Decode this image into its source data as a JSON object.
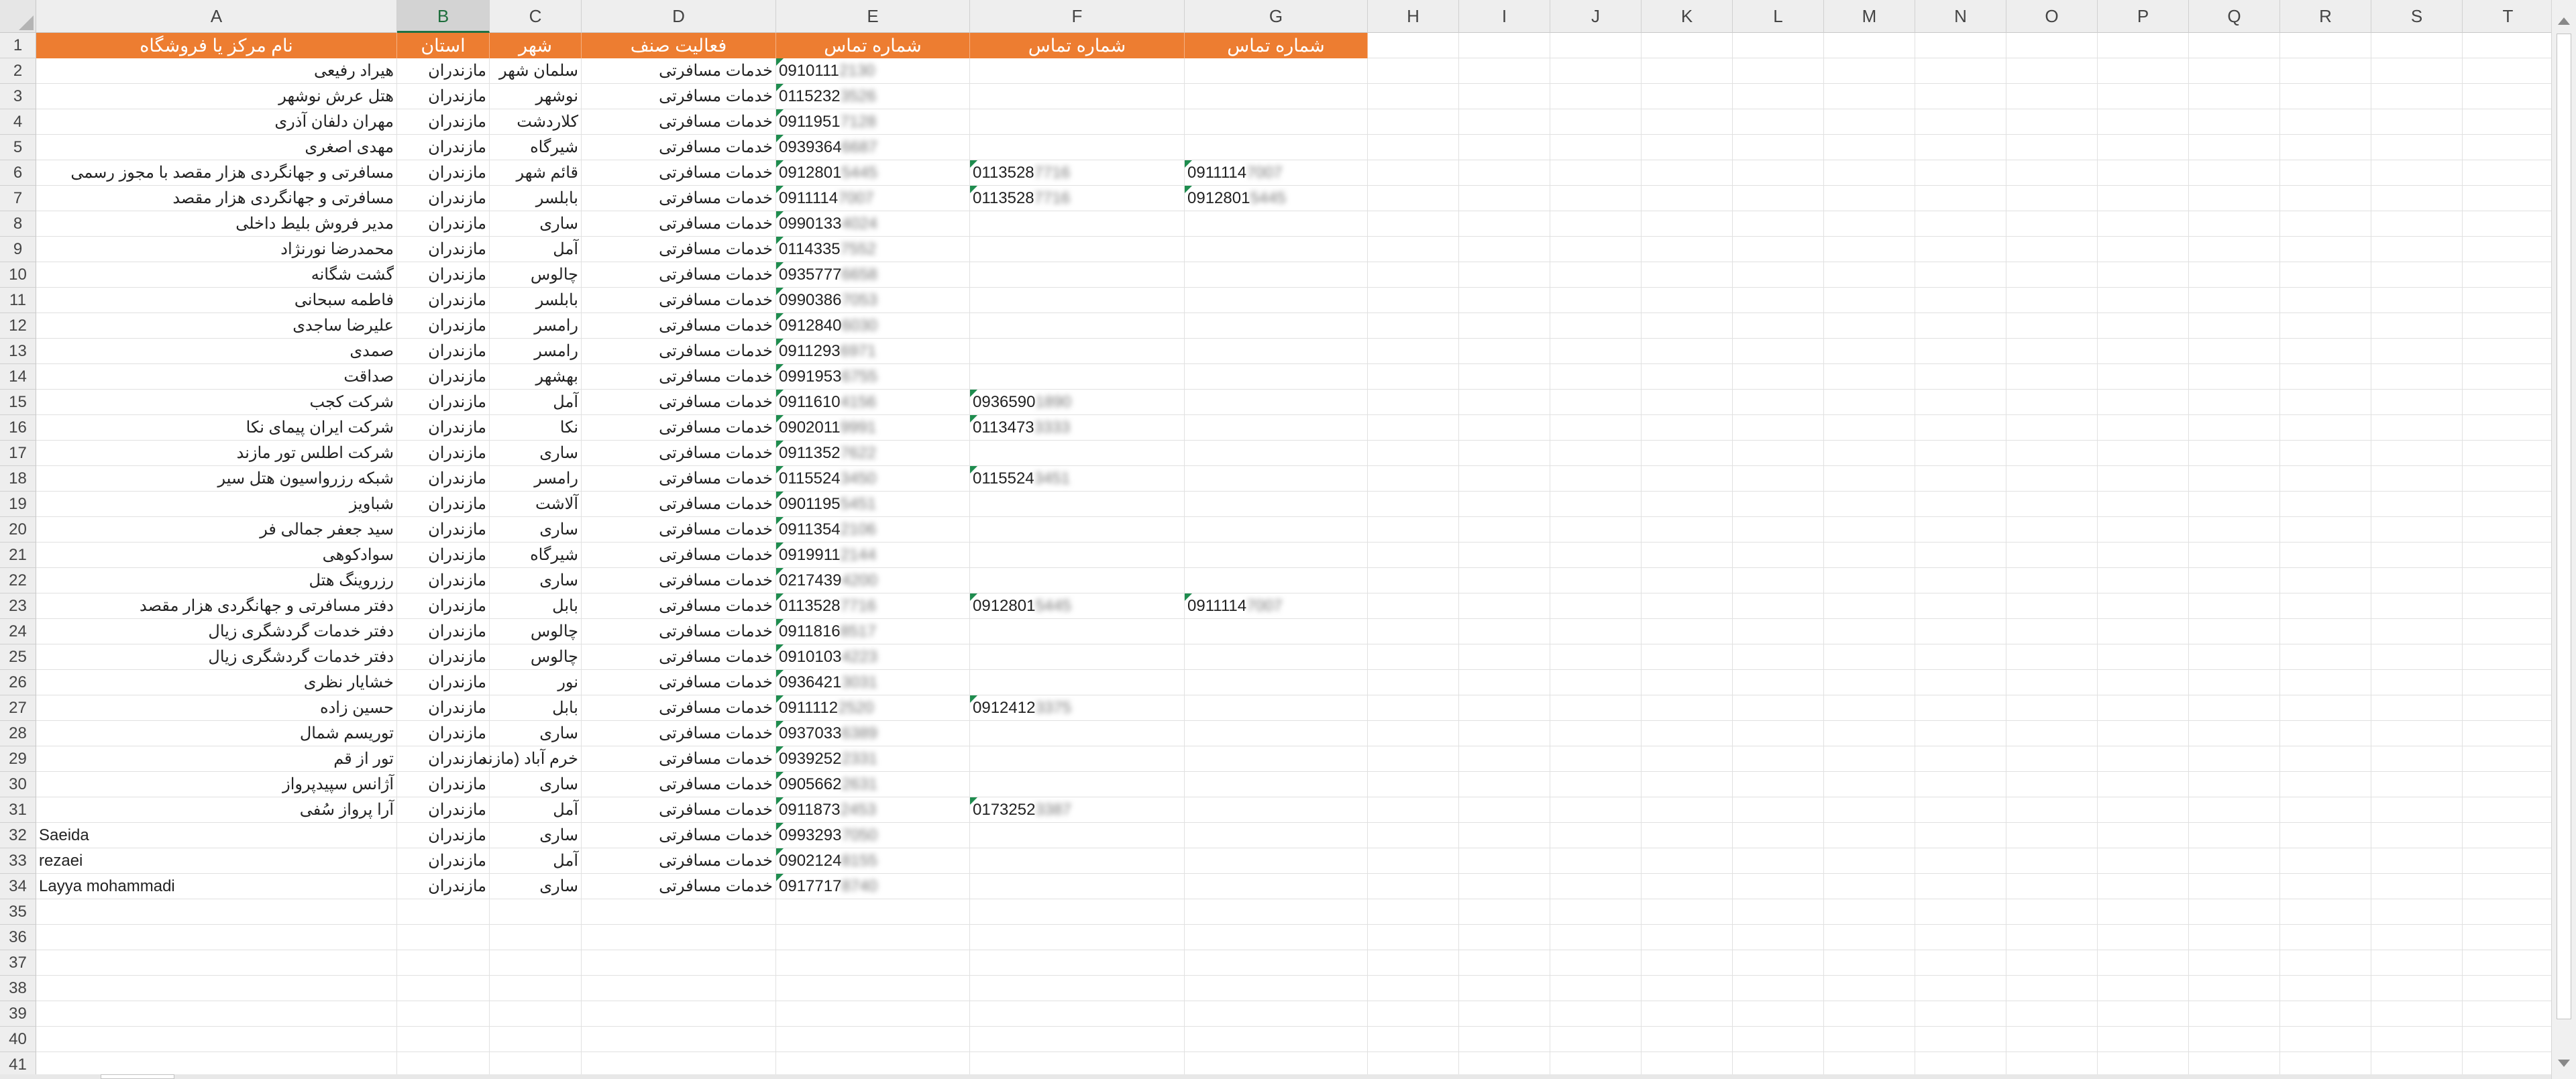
{
  "columns": [
    "A",
    "B",
    "C",
    "D",
    "E",
    "F",
    "G",
    "H",
    "I",
    "J",
    "K",
    "L",
    "M",
    "N",
    "O",
    "P",
    "Q",
    "R",
    "S",
    "T"
  ],
  "selected_column": "B",
  "headers": {
    "A": "نام مرکز یا فروشگاه",
    "B": "استان",
    "C": "شهر",
    "D": "فعالیت صنف",
    "E": "شماره تماس",
    "F": "شماره تماس",
    "G": "شماره تماس"
  },
  "row_numbers": [
    "1",
    "2",
    "3",
    "4",
    "5",
    "6",
    "7",
    "8",
    "9",
    "10",
    "11",
    "12",
    "13",
    "14",
    "15",
    "16",
    "17",
    "18",
    "19",
    "20",
    "21",
    "22",
    "23",
    "24",
    "25",
    "26",
    "27",
    "28",
    "29",
    "30",
    "31",
    "32",
    "33",
    "34",
    "35",
    "36",
    "37",
    "38",
    "39",
    "40",
    "41"
  ],
  "rows": [
    {
      "name": "هیراد رفیعی",
      "province": "مازندران",
      "city": "سلمان شهر",
      "activity": "خدمات مسافرتی",
      "phone1": "0910111",
      "phone1_blur": "2130",
      "phone2": "",
      "phone2_blur": "",
      "phone3": "",
      "phone3_blur": ""
    },
    {
      "name": "هتل عرش نوشهر",
      "province": "مازندران",
      "city": "نوشهر",
      "activity": "خدمات مسافرتی",
      "phone1": "0115232",
      "phone1_blur": "3526",
      "phone2": "",
      "phone2_blur": "",
      "phone3": "",
      "phone3_blur": ""
    },
    {
      "name": "مهران دلفان آذری",
      "province": "مازندران",
      "city": "کلاردشت",
      "activity": "خدمات مسافرتی",
      "phone1": "0911951",
      "phone1_blur": "7128",
      "phone2": "",
      "phone2_blur": "",
      "phone3": "",
      "phone3_blur": ""
    },
    {
      "name": "مهدی اصغری",
      "province": "مازندران",
      "city": "شیرگاه",
      "activity": "خدمات مسافرتی",
      "phone1": "0939364",
      "phone1_blur": "6687",
      "phone2": "",
      "phone2_blur": "",
      "phone3": "",
      "phone3_blur": ""
    },
    {
      "name": "مسافرتی و جهانگردی هزار مقصد با مجوز رسمی",
      "province": "مازندران",
      "city": "قائم شهر",
      "activity": "خدمات مسافرتی",
      "phone1": "0912801",
      "phone1_blur": "5445",
      "phone2": "0113528",
      "phone2_blur": "7716",
      "phone3": "0911114",
      "phone3_blur": "7007"
    },
    {
      "name": "مسافرتی و جهانگردی هزار مقصد",
      "province": "مازندران",
      "city": "بابلسر",
      "activity": "خدمات مسافرتی",
      "phone1": "0911114",
      "phone1_blur": "7007",
      "phone2": "0113528",
      "phone2_blur": "7716",
      "phone3": "0912801",
      "phone3_blur": "5445"
    },
    {
      "name": "مدیر فروش بلیط داخلی",
      "province": "مازندران",
      "city": "ساری",
      "activity": "خدمات مسافرتی",
      "phone1": "0990133",
      "phone1_blur": "4024",
      "phone2": "",
      "phone2_blur": "",
      "phone3": "",
      "phone3_blur": ""
    },
    {
      "name": "محمدرضا نورنژاد",
      "province": "مازندران",
      "city": "آمل",
      "activity": "خدمات مسافرتی",
      "phone1": "0114335",
      "phone1_blur": "7552",
      "phone2": "",
      "phone2_blur": "",
      "phone3": "",
      "phone3_blur": ""
    },
    {
      "name": "گشت شگانه",
      "province": "مازندران",
      "city": "چالوس",
      "activity": "خدمات مسافرتی",
      "phone1": "0935777",
      "phone1_blur": "6658",
      "phone2": "",
      "phone2_blur": "",
      "phone3": "",
      "phone3_blur": ""
    },
    {
      "name": "فاطمه سبحانی",
      "province": "مازندران",
      "city": "بابلسر",
      "activity": "خدمات مسافرتی",
      "phone1": "0990386",
      "phone1_blur": "7053",
      "phone2": "",
      "phone2_blur": "",
      "phone3": "",
      "phone3_blur": ""
    },
    {
      "name": "علیرضا ساجدی",
      "province": "مازندران",
      "city": "رامسر",
      "activity": "خدمات مسافرتی",
      "phone1": "0912840",
      "phone1_blur": "6030",
      "phone2": "",
      "phone2_blur": "",
      "phone3": "",
      "phone3_blur": ""
    },
    {
      "name": "صمدی",
      "province": "مازندران",
      "city": "رامسر",
      "activity": "خدمات مسافرتی",
      "phone1": "0911293",
      "phone1_blur": "6971",
      "phone2": "",
      "phone2_blur": "",
      "phone3": "",
      "phone3_blur": ""
    },
    {
      "name": "صداقت",
      "province": "مازندران",
      "city": "بهشهر",
      "activity": "خدمات مسافرتی",
      "phone1": "0991953",
      "phone1_blur": "6755",
      "phone2": "",
      "phone2_blur": "",
      "phone3": "",
      "phone3_blur": ""
    },
    {
      "name": "شرکت کجب",
      "province": "مازندران",
      "city": "آمل",
      "activity": "خدمات مسافرتی",
      "phone1": "0911610",
      "phone1_blur": "4156",
      "phone2": "0936590",
      "phone2_blur": "1890",
      "phone3": "",
      "phone3_blur": ""
    },
    {
      "name": "شرکت ایران پیمای نکا",
      "province": "مازندران",
      "city": "نکا",
      "activity": "خدمات مسافرتی",
      "phone1": "0902011",
      "phone1_blur": "9991",
      "phone2": "0113473",
      "phone2_blur": "3333",
      "phone3": "",
      "phone3_blur": ""
    },
    {
      "name": "شرکت اطلس تور مازند",
      "province": "مازندران",
      "city": "ساری",
      "activity": "خدمات مسافرتی",
      "phone1": "0911352",
      "phone1_blur": "7622",
      "phone2": "",
      "phone2_blur": "",
      "phone3": "",
      "phone3_blur": ""
    },
    {
      "name": "شبکه رزرواسیون هتل سیر",
      "province": "مازندران",
      "city": "رامسر",
      "activity": "خدمات مسافرتی",
      "phone1": "0115524",
      "phone1_blur": "3450",
      "phone2": "0115524",
      "phone2_blur": "3451",
      "phone3": "",
      "phone3_blur": ""
    },
    {
      "name": "شباویز",
      "province": "مازندران",
      "city": "آلاشت",
      "activity": "خدمات مسافرتی",
      "phone1": "0901195",
      "phone1_blur": "5451",
      "phone2": "",
      "phone2_blur": "",
      "phone3": "",
      "phone3_blur": ""
    },
    {
      "name": "سید جعفر جمالی فر",
      "province": "مازندران",
      "city": "ساری",
      "activity": "خدمات مسافرتی",
      "phone1": "0911354",
      "phone1_blur": "2106",
      "phone2": "",
      "phone2_blur": "",
      "phone3": "",
      "phone3_blur": ""
    },
    {
      "name": "سوادکوهی",
      "province": "مازندران",
      "city": "شیرگاه",
      "activity": "خدمات مسافرتی",
      "phone1": "0919911",
      "phone1_blur": "2144",
      "phone2": "",
      "phone2_blur": "",
      "phone3": "",
      "phone3_blur": ""
    },
    {
      "name": "رزروینگ هتل",
      "province": "مازندران",
      "city": "ساری",
      "activity": "خدمات مسافرتی",
      "phone1": "0217439",
      "phone1_blur": "4200",
      "phone2": "",
      "phone2_blur": "",
      "phone3": "",
      "phone3_blur": ""
    },
    {
      "name": "دفتر مسافرتی و جهانگردی هزار مقصد",
      "province": "مازندران",
      "city": "بابل",
      "activity": "خدمات مسافرتی",
      "phone1": "0113528",
      "phone1_blur": "7716",
      "phone2": "0912801",
      "phone2_blur": "5445",
      "phone3": "0911114",
      "phone3_blur": "7007"
    },
    {
      "name": "دفتر خدمات گردشگری زیال",
      "province": "مازندران",
      "city": "چالوس",
      "activity": "خدمات مسافرتی",
      "phone1": "0911816",
      "phone1_blur": "8517",
      "phone2": "",
      "phone2_blur": "",
      "phone3": "",
      "phone3_blur": ""
    },
    {
      "name": "دفتر خدمات گردشگری زیال",
      "province": "مازندران",
      "city": "چالوس",
      "activity": "خدمات مسافرتی",
      "phone1": "0910103",
      "phone1_blur": "4223",
      "phone2": "",
      "phone2_blur": "",
      "phone3": "",
      "phone3_blur": ""
    },
    {
      "name": "خشایار نظری",
      "province": "مازندران",
      "city": "نور",
      "activity": "خدمات مسافرتی",
      "phone1": "0936421",
      "phone1_blur": "3031",
      "phone2": "",
      "phone2_blur": "",
      "phone3": "",
      "phone3_blur": ""
    },
    {
      "name": "حسین زاده",
      "province": "مازندران",
      "city": "بابل",
      "activity": "خدمات مسافرتی",
      "phone1": "0911112",
      "phone1_blur": "2520",
      "phone2": "0912412",
      "phone2_blur": "3375",
      "phone3": "",
      "phone3_blur": ""
    },
    {
      "name": "توریسم شمال",
      "province": "مازندران",
      "city": "ساری",
      "activity": "خدمات مسافرتی",
      "phone1": "0937033",
      "phone1_blur": "6389",
      "phone2": "",
      "phone2_blur": "",
      "phone3": "",
      "phone3_blur": ""
    },
    {
      "name": "تور از قم",
      "province": "مازندران",
      "city": "خرم آباد (مازند",
      "activity": "خدمات مسافرتی",
      "phone1": "0939252",
      "phone1_blur": "2331",
      "phone2": "",
      "phone2_blur": "",
      "phone3": "",
      "phone3_blur": ""
    },
    {
      "name": "آژانس سپیدپرواز",
      "province": "مازندران",
      "city": "ساری",
      "activity": "خدمات مسافرتی",
      "phone1": "0905662",
      "phone1_blur": "2631",
      "phone2": "",
      "phone2_blur": "",
      "phone3": "",
      "phone3_blur": ""
    },
    {
      "name": "آرا پرواز سُفی",
      "province": "مازندران",
      "city": "آمل",
      "activity": "خدمات مسافرتی",
      "phone1": "0911873",
      "phone1_blur": "2453",
      "phone2": "0173252",
      "phone2_blur": "3387",
      "phone3": "",
      "phone3_blur": ""
    },
    {
      "name": "Saeida",
      "province": "مازندران",
      "city": "ساری",
      "activity": "خدمات مسافرتی",
      "phone1": "0993293",
      "phone1_blur": "7050",
      "phone2": "",
      "phone2_blur": "",
      "phone3": "",
      "phone3_blur": ""
    },
    {
      "name": "rezaei",
      "province": "مازندران",
      "city": "آمل",
      "activity": "خدمات مسافرتی",
      "phone1": "0902124",
      "phone1_blur": "8155",
      "phone2": "",
      "phone2_blur": "",
      "phone3": "",
      "phone3_blur": ""
    },
    {
      "name": "Layya mohammadi",
      "province": "مازندران",
      "city": "ساری",
      "activity": "خدمات مسافرتی",
      "phone1": "0917717",
      "phone1_blur": "8740",
      "phone2": "",
      "phone2_blur": "",
      "phone3": "",
      "phone3_blur": ""
    }
  ],
  "colors": {
    "header_fill": "#ed7d31",
    "header_text": "#ffffff",
    "selection": "#1e7145",
    "comment_marker": "#1e8c4e"
  }
}
